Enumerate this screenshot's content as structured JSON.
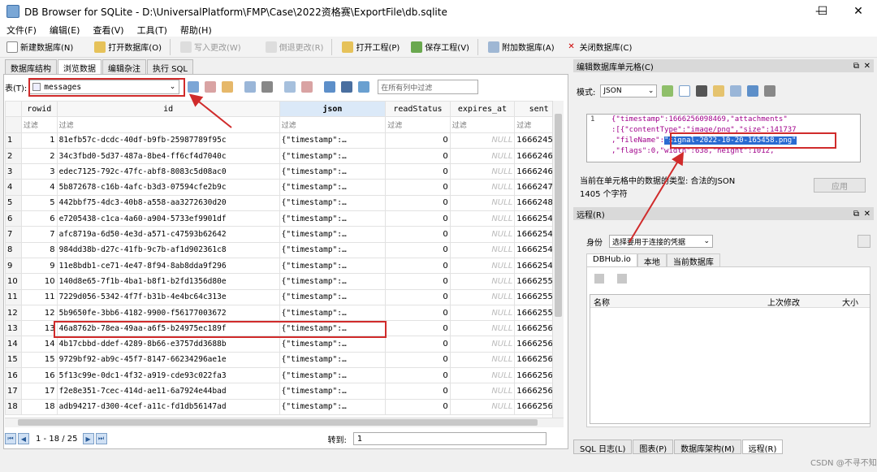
{
  "window": {
    "title": "DB Browser for SQLite - D:\\UniversalPlatform\\FMP\\Case\\2022资格赛\\ExportFile\\db.sqlite",
    "controls": [
      "—",
      "☐",
      "✕"
    ]
  },
  "menu": [
    "文件(F)",
    "编辑(E)",
    "查看(V)",
    "工具(T)",
    "帮助(H)"
  ],
  "toolbar": {
    "new_db": "新建数据库(N)",
    "open_db": "打开数据库(O)",
    "write_changes": "写入更改(W)",
    "revert_changes": "倒退更改(R)",
    "open_project": "打开工程(P)",
    "save_project": "保存工程(V)",
    "attach_db": "附加数据库(A)",
    "close_db": "关闭数据库(C)"
  },
  "tabs": [
    "数据库结构",
    "浏览数据",
    "编辑杂注",
    "执行 SQL"
  ],
  "browse": {
    "table_label": "表(T):",
    "table_value": "messages",
    "filter_all_placeholder": "在所有列中过滤",
    "filter_placeholder": "过滤",
    "columns": [
      "rowid",
      "id",
      "json",
      "readStatus",
      "expires_at",
      "sent"
    ],
    "rows": [
      {
        "n": "1",
        "rowid": "1",
        "id": "81efb57c-dcdc-40df-b9fb-25987789f95c",
        "json": "{\"timestamp\":…",
        "readStatus": "0",
        "expires_at": "NULL",
        "sent": "1666245"
      },
      {
        "n": "2",
        "rowid": "2",
        "id": "34c3fbd0-5d37-487a-8be4-ff6cf4d7040c",
        "json": "{\"timestamp\":…",
        "readStatus": "0",
        "expires_at": "NULL",
        "sent": "1666246"
      },
      {
        "n": "3",
        "rowid": "3",
        "id": "edec7125-792c-47fc-abf8-8083c5d08ac0",
        "json": "{\"timestamp\":…",
        "readStatus": "0",
        "expires_at": "NULL",
        "sent": "1666246"
      },
      {
        "n": "4",
        "rowid": "4",
        "id": "5b872678-c16b-4afc-b3d3-07594cfe2b9c",
        "json": "{\"timestamp\":…",
        "readStatus": "0",
        "expires_at": "NULL",
        "sent": "1666247"
      },
      {
        "n": "5",
        "rowid": "5",
        "id": "442bbf75-4dc3-40b8-a558-aa3272630d20",
        "json": "{\"timestamp\":…",
        "readStatus": "0",
        "expires_at": "NULL",
        "sent": "1666248"
      },
      {
        "n": "6",
        "rowid": "6",
        "id": "e7205438-c1ca-4a60-a904-5733ef9901df",
        "json": "{\"timestamp\":…",
        "readStatus": "0",
        "expires_at": "NULL",
        "sent": "1666254"
      },
      {
        "n": "7",
        "rowid": "7",
        "id": "afc8719a-6d50-4e3d-a571-c47593b62642",
        "json": "{\"timestamp\":…",
        "readStatus": "0",
        "expires_at": "NULL",
        "sent": "1666254"
      },
      {
        "n": "8",
        "rowid": "8",
        "id": "984dd38b-d27c-41fb-9c7b-af1d902361c8",
        "json": "{\"timestamp\":…",
        "readStatus": "0",
        "expires_at": "NULL",
        "sent": "1666254"
      },
      {
        "n": "9",
        "rowid": "9",
        "id": "11e8bdb1-ce71-4e47-8f94-8ab8dda9f296",
        "json": "{\"timestamp\":…",
        "readStatus": "0",
        "expires_at": "NULL",
        "sent": "1666254"
      },
      {
        "n": "10",
        "rowid": "10",
        "id": "140d8e65-7f1b-4ba1-b8f1-b2fd1356d80e",
        "json": "{\"timestamp\":…",
        "readStatus": "0",
        "expires_at": "NULL",
        "sent": "1666255"
      },
      {
        "n": "11",
        "rowid": "11",
        "id": "7229d056-5342-4f7f-b31b-4e4bc64c313e",
        "json": "{\"timestamp\":…",
        "readStatus": "0",
        "expires_at": "NULL",
        "sent": "1666255"
      },
      {
        "n": "12",
        "rowid": "12",
        "id": "5b9650fe-3bb6-4182-9900-f56177003672",
        "json": "{\"timestamp\":…",
        "readStatus": "0",
        "expires_at": "NULL",
        "sent": "1666255"
      },
      {
        "n": "13",
        "rowid": "13",
        "id": "46a8762b-78ea-49aa-a6f5-b24975ec189f",
        "json": "{\"timestamp\":…",
        "readStatus": "0",
        "expires_at": "NULL",
        "sent": "1666256"
      },
      {
        "n": "14",
        "rowid": "14",
        "id": "4b17cbbd-ddef-4289-8b66-e3757dd3688b",
        "json": "{\"timestamp\":…",
        "readStatus": "0",
        "expires_at": "NULL",
        "sent": "1666256"
      },
      {
        "n": "15",
        "rowid": "15",
        "id": "9729bf92-ab9c-45f7-8147-66234296ae1e",
        "json": "{\"timestamp\":…",
        "readStatus": "0",
        "expires_at": "NULL",
        "sent": "1666256"
      },
      {
        "n": "16",
        "rowid": "16",
        "id": "5f13c99e-0dc1-4f32-a919-cde93c022fa3",
        "json": "{\"timestamp\":…",
        "readStatus": "0",
        "expires_at": "NULL",
        "sent": "1666256"
      },
      {
        "n": "17",
        "rowid": "17",
        "id": "f2e8e351-7cec-414d-ae11-6a7924e44bad",
        "json": "{\"timestamp\":…",
        "readStatus": "0",
        "expires_at": "NULL",
        "sent": "1666256"
      },
      {
        "n": "18",
        "rowid": "18",
        "id": "adb94217-d300-4cef-a11c-fd1db56147ad",
        "json": "{\"timestamp\":…",
        "readStatus": "0",
        "expires_at": "NULL",
        "sent": "1666256"
      }
    ],
    "pagination": "1 - 18 / 25",
    "goto_label": "转到:",
    "goto_value": "1"
  },
  "cell_editor": {
    "title": "编辑数据库单元格(C)",
    "mode_label": "模式:",
    "mode_value": "JSON",
    "line_number": "1",
    "json_lines": [
      "{\"timestamp\":1666256098469,\"attachments\"",
      ":[{\"contentType\":\"image/png\",\"size\":141737",
      ",\"fileName\":",
      ",\"flags\":0,\"width\":638,\"height\":1012,"
    ],
    "highlight_value": "\"signal-2022-10-20-165458.png\"",
    "type_info": "当前在单元格中的数据的类型: 合法的JSON",
    "char_count": "1405 个字符",
    "apply_button": "应用"
  },
  "remote": {
    "title": "远程(R)",
    "identity_label": "身份",
    "identity_value": "选择要用于连接的凭据",
    "tabs": [
      "DBHub.io",
      "本地",
      "当前数据库"
    ],
    "columns": [
      "名称",
      "上次修改",
      "大小"
    ]
  },
  "bottom_tabs": [
    "SQL 日志(L)",
    "图表(P)",
    "数据库架构(M)",
    "远程(R)"
  ],
  "watermark": "CSDN @不寻不知",
  "colors": {
    "annotation": "#d02b2b",
    "accent": "#2a5c99"
  }
}
